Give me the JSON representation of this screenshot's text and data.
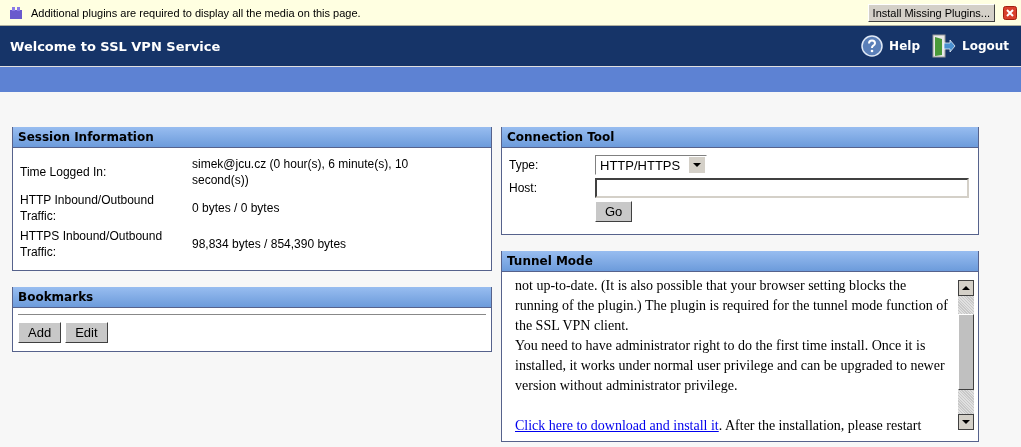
{
  "infobar": {
    "message": "Additional plugins are required to display all the media on this page.",
    "button": "Install Missing Plugins..."
  },
  "header": {
    "title": "Welcome to SSL VPN Service",
    "links": [
      {
        "kind": "help",
        "label": "Help"
      },
      {
        "kind": "logout",
        "label": "Logout"
      }
    ]
  },
  "session": {
    "title": "Session Information",
    "rows": [
      {
        "label": "Time Logged In:",
        "value": "simek@jcu.cz (0 hour(s), 6 minute(s), 10 second(s))"
      },
      {
        "label": "HTTP Inbound/Outbound Traffic:",
        "value": "0 bytes / 0 bytes"
      },
      {
        "label": "HTTPS Inbound/Outbound Traffic:",
        "value": "98,834 bytes / 854,390 bytes"
      }
    ]
  },
  "bookmarks": {
    "title": "Bookmarks",
    "buttons": [
      "Add",
      "Edit"
    ]
  },
  "connection": {
    "title": "Connection Tool",
    "type_label": "Type:",
    "type_value": "HTTP/HTTPS",
    "host_label": "Host:",
    "button": "Go"
  },
  "tunnel": {
    "title": "Tunnel Mode",
    "paragraphs": [
      {
        "text": "not up-to-date. (It is also possible that your browser setting blocks the running of the plugin.) The plugin is required for the tunnel mode function of the SSL VPN client."
      },
      {
        "text": "You need to have administrator right to do the first time install. Once it is installed, it works under normal user privilege and can be upgraded to newer version without administrator privilege."
      },
      {
        "link": "Click here to download and install it",
        "text": ". After the installation, please restart"
      }
    ]
  }
}
